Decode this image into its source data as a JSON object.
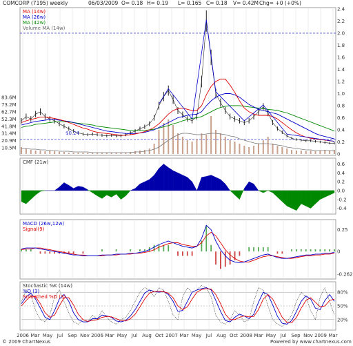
{
  "header": {
    "symbol": "COMCORP (7195) weekly",
    "date": "06/03/2009",
    "open": "O= 0.18",
    "high": "H= 0.19",
    "low": "L= 0.165",
    "close": "C= 0.18",
    "volume": "V= 0.42M",
    "change": "Chg= +0 (+0%)"
  },
  "footer": {
    "copyright": "© 2009 ChartNexus",
    "powered": "Powered by www.chartnexus.com"
  },
  "colors": {
    "price": "#222222",
    "ma14": "#e00000",
    "ma26": "#0000cc",
    "ma42": "#008800",
    "volume": "#c8a08c",
    "cmf_pos": "#0000aa",
    "cmf_neg": "#008800",
    "macd": "#0000cc",
    "signal": "#e00000",
    "stoch_k": "#444444",
    "stoch_d": "#0000cc",
    "stoch_smooth": "#e00000",
    "ref_line": "#3333cc"
  },
  "x_axis": {
    "labels": [
      "2006",
      "Mar",
      "May",
      "Jul",
      "Sep",
      "Nov",
      "2006",
      "Mar",
      "May",
      "Jul",
      "Aug",
      "Oct",
      "2007",
      "Mar",
      "May",
      "Jul",
      "Aug",
      "Oct",
      "2008",
      "Mar",
      "May",
      "Jul",
      "Sep",
      "Nov",
      "2009",
      "Mar"
    ]
  },
  "chart_data": [
    {
      "type": "line",
      "panel": "price",
      "legend": [
        "MA (14w)",
        "MA (26w)",
        "MA (42w)",
        "Volume MA (14w)"
      ],
      "ref_label": "$0.24",
      "ylim": [
        0,
        2.4
      ],
      "y_ticks": [
        "0",
        "0.2",
        "0.4",
        "0.6",
        "0.8",
        "1.0",
        "1.2",
        "1.4",
        "1.6",
        "1.8",
        "2.0",
        "2.2",
        "2.4"
      ],
      "volume_ticks": [
        "10.5M",
        "20.9M",
        "31.4M",
        "41.8M",
        "52.3M",
        "62.7M",
        "73.2M",
        "83.6M"
      ],
      "ref_lines": [
        0.24,
        2.0
      ],
      "close": [
        0.55,
        0.62,
        0.58,
        0.66,
        0.7,
        0.62,
        0.58,
        0.55,
        0.5,
        0.46,
        0.42,
        0.38,
        0.35,
        0.33,
        0.32,
        0.33,
        0.32,
        0.31,
        0.3,
        0.31,
        0.3,
        0.3,
        0.32,
        0.35,
        0.38,
        0.42,
        0.45,
        0.5,
        0.6,
        0.8,
        0.95,
        1.05,
        0.9,
        0.72,
        0.65,
        0.58,
        0.55,
        0.62,
        1.2,
        2.2,
        1.6,
        1.0,
        0.85,
        0.72,
        0.62,
        0.58,
        0.55,
        0.52,
        0.55,
        0.62,
        0.7,
        0.78,
        0.68,
        0.52,
        0.42,
        0.36,
        0.3,
        0.26,
        0.24,
        0.23,
        0.22,
        0.22,
        0.21,
        0.2,
        0.19,
        0.18,
        0.18
      ],
      "ma14": [
        0.52,
        0.55,
        0.57,
        0.59,
        0.61,
        0.61,
        0.6,
        0.59,
        0.57,
        0.55,
        0.52,
        0.49,
        0.46,
        0.43,
        0.41,
        0.38,
        0.36,
        0.35,
        0.34,
        0.33,
        0.32,
        0.31,
        0.31,
        0.32,
        0.33,
        0.35,
        0.37,
        0.4,
        0.44,
        0.5,
        0.58,
        0.66,
        0.72,
        0.75,
        0.76,
        0.74,
        0.72,
        0.72,
        0.8,
        0.98,
        1.12,
        1.2,
        1.24,
        1.24,
        1.14,
        1.02,
        0.88,
        0.76,
        0.7,
        0.66,
        0.64,
        0.64,
        0.64,
        0.62,
        0.58,
        0.52,
        0.46,
        0.4,
        0.35,
        0.31,
        0.28,
        0.26,
        0.25,
        0.24,
        0.23,
        0.22,
        0.21
      ],
      "ma26": [
        0.48,
        0.5,
        0.52,
        0.54,
        0.55,
        0.56,
        0.57,
        0.57,
        0.56,
        0.55,
        0.54,
        0.52,
        0.5,
        0.48,
        0.46,
        0.44,
        0.42,
        0.4,
        0.38,
        0.37,
        0.36,
        0.35,
        0.34,
        0.34,
        0.34,
        0.35,
        0.36,
        0.38,
        0.4,
        0.44,
        0.48,
        0.52,
        0.56,
        0.6,
        0.62,
        0.64,
        0.65,
        0.66,
        0.7,
        0.8,
        0.88,
        0.94,
        0.98,
        1.0,
        1.0,
        0.98,
        0.94,
        0.88,
        0.82,
        0.78,
        0.74,
        0.72,
        0.7,
        0.68,
        0.66,
        0.62,
        0.58,
        0.54,
        0.5,
        0.46,
        0.42,
        0.38,
        0.34,
        0.31,
        0.29,
        0.27,
        0.25
      ],
      "ma42": [
        0.44,
        0.46,
        0.47,
        0.49,
        0.5,
        0.51,
        0.52,
        0.53,
        0.53,
        0.53,
        0.53,
        0.52,
        0.51,
        0.5,
        0.49,
        0.48,
        0.46,
        0.45,
        0.44,
        0.43,
        0.42,
        0.41,
        0.4,
        0.39,
        0.39,
        0.39,
        0.39,
        0.4,
        0.41,
        0.43,
        0.45,
        0.47,
        0.5,
        0.52,
        0.55,
        0.57,
        0.59,
        0.6,
        0.62,
        0.66,
        0.7,
        0.74,
        0.77,
        0.79,
        0.8,
        0.8,
        0.8,
        0.79,
        0.78,
        0.77,
        0.76,
        0.75,
        0.74,
        0.73,
        0.72,
        0.7,
        0.68,
        0.65,
        0.62,
        0.59,
        0.56,
        0.53,
        0.5,
        0.47,
        0.44,
        0.41,
        0.38
      ],
      "volume": [
        0.1,
        0.08,
        0.06,
        0.05,
        0.05,
        0.04,
        0.05,
        0.04,
        0.03,
        0.03,
        0.02,
        0.02,
        0.02,
        0.02,
        0.02,
        0.02,
        0.02,
        0.02,
        0.02,
        0.02,
        0.02,
        0.02,
        0.02,
        0.03,
        0.04,
        0.05,
        0.06,
        0.08,
        0.15,
        0.35,
        0.45,
        0.5,
        0.42,
        0.3,
        0.25,
        0.2,
        0.18,
        0.22,
        0.3,
        0.28,
        0.55,
        0.35,
        0.3,
        0.25,
        0.2,
        0.18,
        0.15,
        0.12,
        0.1,
        0.12,
        0.15,
        0.2,
        0.25,
        0.15,
        0.12,
        0.1,
        0.08,
        0.06,
        0.05,
        0.05,
        0.04,
        0.05,
        0.04,
        0.05,
        0.06,
        0.05,
        0.06
      ],
      "volume_ma": [
        0.08,
        0.08,
        0.07,
        0.07,
        0.06,
        0.06,
        0.05,
        0.05,
        0.04,
        0.04,
        0.04,
        0.03,
        0.03,
        0.03,
        0.03,
        0.02,
        0.02,
        0.02,
        0.02,
        0.02,
        0.02,
        0.02,
        0.02,
        0.02,
        0.03,
        0.03,
        0.04,
        0.05,
        0.07,
        0.1,
        0.15,
        0.2,
        0.24,
        0.28,
        0.3,
        0.3,
        0.29,
        0.28,
        0.28,
        0.29,
        0.3,
        0.3,
        0.29,
        0.28,
        0.26,
        0.25,
        0.22,
        0.2,
        0.18,
        0.16,
        0.15,
        0.15,
        0.15,
        0.14,
        0.13,
        0.12,
        0.1,
        0.09,
        0.08,
        0.07,
        0.06,
        0.06,
        0.05,
        0.05,
        0.05,
        0.05,
        0.05
      ]
    },
    {
      "type": "area",
      "panel": "cmf",
      "legend": [
        "CMF (21w)"
      ],
      "ylim": [
        -0.5,
        0.7
      ],
      "y_ticks": [
        "0.6",
        "0.4",
        "0.2",
        "0.0",
        "-0.2",
        "-0.4"
      ],
      "values": [
        -0.25,
        -0.3,
        -0.2,
        -0.1,
        -0.02,
        0.0,
        0.0,
        0.0,
        0.08,
        0.18,
        0.12,
        0.05,
        0.1,
        0.08,
        0.02,
        -0.05,
        -0.12,
        -0.18,
        -0.1,
        -0.15,
        -0.08,
        -0.2,
        -0.12,
        0.0,
        0.05,
        0.15,
        0.2,
        0.25,
        0.35,
        0.5,
        0.6,
        0.52,
        0.45,
        0.4,
        0.35,
        0.3,
        0.2,
        0.0,
        0.3,
        0.32,
        0.35,
        0.3,
        0.25,
        0.15,
        0.0,
        -0.1,
        -0.2,
        0.05,
        0.2,
        0.15,
        0.0,
        -0.05,
        0.0,
        -0.05,
        -0.15,
        -0.25,
        -0.35,
        -0.4,
        -0.45,
        -0.3,
        -0.35,
        -0.4,
        -0.3,
        -0.2,
        -0.15,
        -0.1,
        -0.05
      ]
    },
    {
      "type": "line",
      "panel": "macd",
      "legend": [
        "MACD (26w,12w)",
        "Signal(9)"
      ],
      "ylim": [
        -0.3,
        0.35
      ],
      "y_ticks": [
        "0.25",
        "0",
        "-0.262"
      ],
      "macd": [
        0.03,
        0.04,
        0.04,
        0.04,
        0.03,
        0.02,
        0.01,
        0.0,
        -0.01,
        -0.02,
        -0.03,
        -0.04,
        -0.04,
        -0.05,
        -0.05,
        -0.05,
        -0.05,
        -0.04,
        -0.04,
        -0.04,
        -0.03,
        -0.03,
        -0.03,
        -0.02,
        -0.02,
        -0.01,
        0.0,
        0.02,
        0.05,
        0.08,
        0.1,
        0.12,
        0.1,
        0.08,
        0.06,
        0.05,
        0.04,
        0.06,
        0.15,
        0.3,
        0.25,
        0.12,
        0.02,
        -0.05,
        -0.1,
        -0.12,
        -0.13,
        -0.12,
        -0.1,
        -0.08,
        -0.06,
        -0.04,
        -0.03,
        -0.05,
        -0.07,
        -0.08,
        -0.08,
        -0.07,
        -0.06,
        -0.05,
        -0.04,
        -0.04,
        -0.03,
        -0.03,
        -0.02,
        -0.02,
        -0.01
      ],
      "signal": [
        0.02,
        0.03,
        0.03,
        0.04,
        0.04,
        0.03,
        0.02,
        0.01,
        0.0,
        -0.01,
        -0.02,
        -0.03,
        -0.04,
        -0.04,
        -0.05,
        -0.05,
        -0.05,
        -0.05,
        -0.04,
        -0.04,
        -0.04,
        -0.03,
        -0.03,
        -0.03,
        -0.02,
        -0.02,
        -0.01,
        0.0,
        0.02,
        0.05,
        0.07,
        0.09,
        0.1,
        0.1,
        0.08,
        0.07,
        0.06,
        0.06,
        0.1,
        0.18,
        0.22,
        0.18,
        0.1,
        0.02,
        -0.04,
        -0.08,
        -0.11,
        -0.12,
        -0.12,
        -0.1,
        -0.08,
        -0.06,
        -0.05,
        -0.05,
        -0.06,
        -0.07,
        -0.08,
        -0.08,
        -0.07,
        -0.06,
        -0.05,
        -0.05,
        -0.04,
        -0.04,
        -0.03,
        -0.03,
        -0.02
      ]
    },
    {
      "type": "line",
      "panel": "stochastic",
      "legend": [
        "Stochastic %K (14w)",
        "%D (3)",
        "Smoothed %D (3)"
      ],
      "ylim": [
        0,
        100
      ],
      "y_ticks": [
        "80%",
        "50%",
        "20%"
      ],
      "k": [
        60,
        85,
        75,
        40,
        20,
        15,
        30,
        70,
        85,
        60,
        35,
        15,
        10,
        20,
        15,
        30,
        20,
        40,
        25,
        15,
        10,
        20,
        25,
        40,
        60,
        80,
        90,
        85,
        70,
        90,
        85,
        60,
        30,
        20,
        70,
        90,
        80,
        85,
        95,
        90,
        70,
        30,
        15,
        10,
        20,
        40,
        30,
        15,
        20,
        60,
        90,
        85,
        50,
        20,
        10,
        5,
        15,
        30,
        60,
        80,
        70,
        40,
        20,
        70,
        90,
        60,
        30
      ],
      "d": [
        55,
        70,
        78,
        65,
        45,
        25,
        20,
        40,
        65,
        75,
        60,
        35,
        20,
        15,
        15,
        22,
        22,
        30,
        28,
        25,
        17,
        15,
        18,
        28,
        42,
        60,
        78,
        85,
        82,
        80,
        82,
        75,
        60,
        38,
        40,
        60,
        80,
        85,
        88,
        90,
        85,
        62,
        38,
        18,
        15,
        25,
        32,
        28,
        22,
        32,
        58,
        80,
        75,
        52,
        27,
        12,
        10,
        18,
        38,
        60,
        72,
        65,
        45,
        42,
        62,
        75,
        60
      ],
      "smooth": [
        50,
        62,
        72,
        70,
        55,
        35,
        25,
        30,
        50,
        68,
        68,
        52,
        32,
        20,
        16,
        18,
        20,
        25,
        27,
        26,
        22,
        18,
        17,
        22,
        32,
        48,
        65,
        78,
        82,
        82,
        81,
        78,
        68,
        50,
        42,
        48,
        65,
        80,
        86,
        88,
        87,
        75,
        55,
        32,
        20,
        20,
        25,
        28,
        26,
        27,
        42,
        65,
        75,
        65,
        45,
        25,
        14,
        13,
        25,
        45,
        62,
        68,
        58,
        48,
        50,
        62,
        65
      ]
    }
  ]
}
